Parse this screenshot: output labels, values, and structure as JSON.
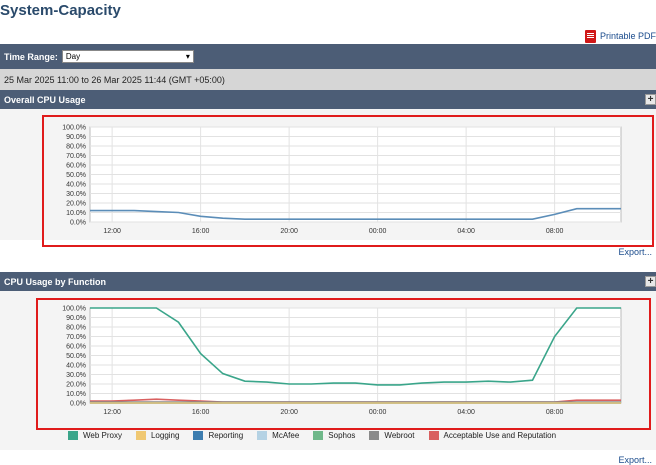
{
  "page": {
    "title": "System-Capacity",
    "printable_pdf": "Printable PDF",
    "time_range_label": "Time Range:",
    "time_range_value": "Day",
    "date_range": "25 Mar 2025 11:00 to 26 Mar 2025 11:44 (GMT +05:00)",
    "export_label": "Export..."
  },
  "sections": [
    {
      "title": "Overall CPU Usage"
    },
    {
      "title": "CPU Usage by Function"
    }
  ],
  "icons": {
    "pdf": "pdf-icon",
    "expand": "plus-icon",
    "dropdown": "chevron-down-icon"
  },
  "chart_data": [
    {
      "type": "line",
      "y_ticks": [
        "100.0%",
        "90.0%",
        "80.0%",
        "70.0%",
        "60.0%",
        "50.0%",
        "40.0%",
        "30.0%",
        "20.0%",
        "10.0%",
        "0.0%"
      ],
      "x_ticks": [
        "12:00",
        "16:00",
        "20:00",
        "00:00",
        "04:00",
        "08:00"
      ],
      "ylim": [
        0,
        100
      ],
      "x_hours_from_11": [
        0,
        1,
        2,
        3,
        4,
        5,
        6,
        7,
        8,
        9,
        10,
        11,
        12,
        13,
        14,
        15,
        16,
        17,
        18,
        19,
        20,
        21,
        22,
        23,
        24
      ],
      "series": [
        {
          "color": "#5b8db8",
          "values": [
            12,
            12,
            12,
            11,
            10,
            6,
            4,
            3,
            3,
            3,
            3,
            3,
            3,
            3,
            3,
            3,
            3,
            3,
            3,
            3,
            3,
            8,
            14,
            14,
            14
          ]
        }
      ]
    },
    {
      "type": "line",
      "y_ticks": [
        "100.0%",
        "90.0%",
        "80.0%",
        "70.0%",
        "60.0%",
        "50.0%",
        "40.0%",
        "30.0%",
        "20.0%",
        "10.0%",
        "0.0%"
      ],
      "x_ticks": [
        "12:00",
        "16:00",
        "20:00",
        "00:00",
        "04:00",
        "08:00"
      ],
      "ylim": [
        0,
        100
      ],
      "x_hours_from_11": [
        0,
        1,
        2,
        3,
        4,
        5,
        6,
        7,
        8,
        9,
        10,
        11,
        12,
        13,
        14,
        15,
        16,
        17,
        18,
        19,
        20,
        21,
        22,
        23,
        24
      ],
      "series": [
        {
          "name": "Web Proxy",
          "color": "#3aa58a",
          "values": [
            100,
            100,
            100,
            100,
            85,
            52,
            31,
            23,
            22,
            20,
            20,
            21,
            21,
            19,
            19,
            21,
            22,
            22,
            23,
            22,
            24,
            70,
            100,
            100,
            100
          ]
        },
        {
          "name": "Logging",
          "color": "#f0c872",
          "values": [
            0,
            0,
            0,
            0,
            0,
            0,
            0,
            0,
            0,
            0,
            0,
            0,
            0,
            0,
            0,
            0,
            0,
            0,
            0,
            0,
            0,
            0,
            0,
            0,
            0
          ]
        },
        {
          "name": "Reporting",
          "color": "#3d7db0",
          "values": [
            0,
            0,
            0,
            0,
            0,
            0,
            0,
            0,
            0,
            0,
            0,
            0,
            0,
            0,
            0,
            0,
            0,
            0,
            0,
            0,
            0,
            0,
            0,
            0,
            0
          ]
        },
        {
          "name": "McAfee",
          "color": "#b4d2e4",
          "values": [
            0,
            0,
            0,
            0,
            0,
            0,
            0,
            0,
            0,
            0,
            0,
            0,
            0,
            0,
            0,
            0,
            0,
            0,
            0,
            0,
            0,
            0,
            0,
            0,
            0
          ]
        },
        {
          "name": "Sophos",
          "color": "#6fb88a",
          "values": [
            0,
            0,
            0,
            0,
            0,
            0,
            0,
            0,
            0,
            0,
            0,
            0,
            0,
            0,
            0,
            0,
            0,
            0,
            0,
            0,
            0,
            0,
            0,
            0,
            0
          ]
        },
        {
          "name": "Webroot",
          "color": "#8a8a8a",
          "values": [
            1,
            1,
            1,
            1,
            1,
            1,
            1,
            1,
            1,
            1,
            1,
            1,
            1,
            1,
            1,
            1,
            1,
            1,
            1,
            1,
            1,
            1,
            1,
            1,
            1
          ]
        },
        {
          "name": "Acceptable Use and Reputation",
          "color": "#d96060",
          "values": [
            2,
            2,
            3,
            4,
            3,
            2,
            1,
            1,
            1,
            1,
            1,
            1,
            1,
            1,
            1,
            1,
            1,
            1,
            1,
            1,
            1,
            1,
            3,
            3,
            3
          ]
        }
      ]
    }
  ]
}
